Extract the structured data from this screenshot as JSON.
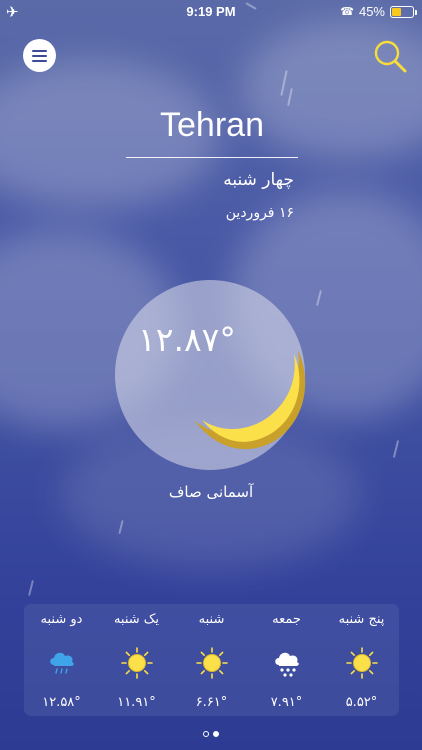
{
  "status_bar": {
    "time": "9:19 PM",
    "battery_text": "45%",
    "battery_level": 0.45
  },
  "header": {
    "menu_icon": "hamburger-menu-icon",
    "search_icon": "search-icon"
  },
  "location": {
    "city": "Tehran",
    "day": "چهار شنبه",
    "date": "۱۶ فروردین"
  },
  "current": {
    "temperature": "۱۲.۸۷°",
    "condition": "آسمانی صاف",
    "icon": "crescent-moon-icon"
  },
  "forecast": [
    {
      "day": "پنج شنبه",
      "temp": "۵.۵۲°",
      "icon": "sun-icon"
    },
    {
      "day": "جمعه",
      "temp": "۷.۹۱°",
      "icon": "snow-cloud-icon"
    },
    {
      "day": "شنبه",
      "temp": "۶.۶۱°",
      "icon": "sun-icon"
    },
    {
      "day": "یک شنبه",
      "temp": "۱۱.۹۱°",
      "icon": "sun-icon"
    },
    {
      "day": "دو شنبه",
      "temp": "۱۲.۵۸°",
      "icon": "rain-cloud-icon"
    }
  ],
  "pager": {
    "pages": 2,
    "active_index": 1
  },
  "colors": {
    "accent_yellow": "#f7dc3c",
    "sun_yellow": "#fbe04a",
    "rain_blue": "#3fa4ea",
    "panel": "#4b5aa5"
  }
}
